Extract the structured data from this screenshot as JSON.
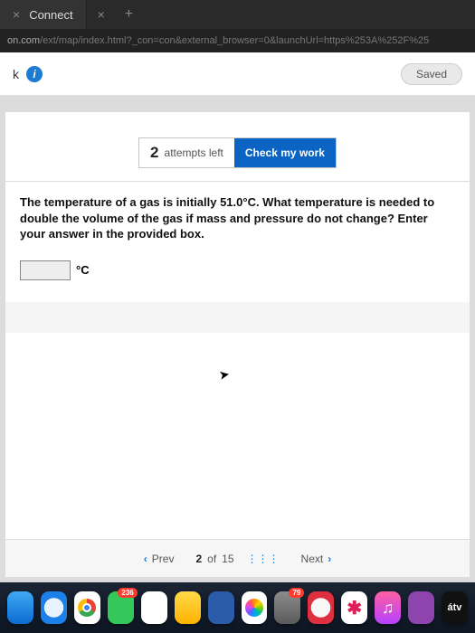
{
  "browser": {
    "tab_title": "Connect",
    "close_glyph": "×",
    "add_glyph": "+",
    "url_domain": "on.com",
    "url_path": "/ext/map/index.html?_con=con&external_browser=0&launchUrl=https%253A%252F%25"
  },
  "header": {
    "left_label": "k",
    "info_glyph": "i",
    "saved_label": "Saved"
  },
  "attempts": {
    "count": "2",
    "label": "attempts left",
    "check_label": "Check my work"
  },
  "question": {
    "text": "The temperature of a gas is initially 51.0°C. What temperature is needed to double the volume of the gas if mass and pressure do not change? Enter your answer in the provided box.",
    "unit": "°C",
    "answer_value": ""
  },
  "pager": {
    "prev": "Prev",
    "current": "2",
    "of": "of",
    "total": "15",
    "next": "Next",
    "left_arrow": "‹",
    "right_arrow": "›",
    "grid_glyph": "⋮⋮⋮"
  },
  "dock": {
    "messages_badge": "236",
    "launchpad_badge": "79",
    "appletv_label": "átv",
    "music_glyph": "♫"
  }
}
